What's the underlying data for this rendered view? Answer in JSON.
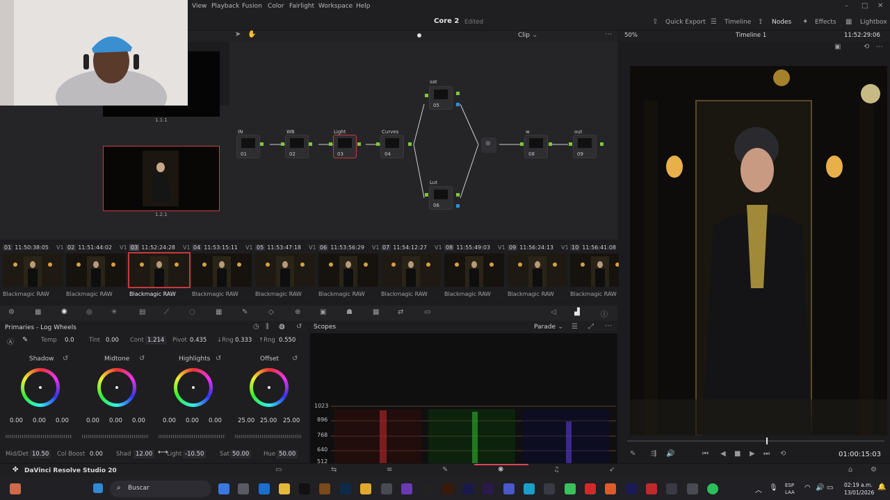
{
  "menu": {
    "items": [
      "View",
      "Playback",
      "Fusion",
      "Color",
      "Fairlight",
      "Workspace",
      "Help"
    ]
  },
  "header": {
    "project": "Core 2",
    "status": "Edited",
    "quick_export": "Quick Export",
    "timeline": "Timeline",
    "nodes": "Nodes",
    "effects": "Effects",
    "lightbox": "Lightbox"
  },
  "viewerbar": {
    "zoom": "50%",
    "timeline_name": "Timeline 1",
    "timecode": "11:52:29:06"
  },
  "nodebar": {
    "mode": "Clip"
  },
  "gallery": {
    "still1": "1.1.1",
    "still2": "1.2.1"
  },
  "nodes": [
    {
      "label": "IN",
      "num": "01"
    },
    {
      "label": "WB",
      "num": "02"
    },
    {
      "label": "Light",
      "num": "03"
    },
    {
      "label": "Curves",
      "num": "04"
    },
    {
      "label": "sat",
      "num": "05"
    },
    {
      "label": "Lut",
      "num": "06"
    },
    {
      "label": "w",
      "num": "08"
    },
    {
      "label": "out",
      "num": "09"
    }
  ],
  "clips": [
    {
      "num": "01",
      "tc": "11:50:38:05",
      "track": "V1",
      "codec": "Blackmagic RAW"
    },
    {
      "num": "02",
      "tc": "11:51:44:02",
      "track": "V1",
      "codec": "Blackmagic RAW"
    },
    {
      "num": "03",
      "tc": "11:52:24:28",
      "track": "V1",
      "codec": "Blackmagic RAW"
    },
    {
      "num": "04",
      "tc": "11:53:15:11",
      "track": "V1",
      "codec": "Blackmagic RAW"
    },
    {
      "num": "05",
      "tc": "11:53:47:18",
      "track": "V1",
      "codec": "Blackmagic RAW"
    },
    {
      "num": "06",
      "tc": "11:53:56:29",
      "track": "V1",
      "codec": "Blackmagic RAW"
    },
    {
      "num": "07",
      "tc": "11:54:12:27",
      "track": "V1",
      "codec": "Blackmagic RAW"
    },
    {
      "num": "08",
      "tc": "11:55:49:03",
      "track": "V1",
      "codec": "Blackmagic RAW"
    },
    {
      "num": "09",
      "tc": "11:56:24:13",
      "track": "V1",
      "codec": "Blackmagic RAW"
    },
    {
      "num": "10",
      "tc": "11:56:41:08",
      "track": "",
      "codec": "Blackmagic RAW"
    }
  ],
  "primaries": {
    "title": "Primaries - Log Wheels",
    "temp_label": "Temp",
    "temp": "0.0",
    "tint_label": "Tint",
    "tint": "0.00",
    "cont_label": "Cont",
    "cont": "1.214",
    "pivot_label": "Pivot",
    "pivot": "0.435",
    "lrng_label": "↓Rng",
    "lrng": "0.333",
    "hrng_label": "↑Rng",
    "hrng": "0.550",
    "wheels": [
      {
        "name": "Shadow",
        "v": [
          "0.00",
          "0.00",
          "0.00"
        ]
      },
      {
        "name": "Midtone",
        "v": [
          "0.00",
          "0.00",
          "0.00"
        ]
      },
      {
        "name": "Highlights",
        "v": [
          "0.00",
          "0.00",
          "0.00"
        ]
      },
      {
        "name": "Offset",
        "v": [
          "25.00",
          "25.00",
          "25.00"
        ]
      }
    ],
    "middet_label": "Mid/Det",
    "middet": "10.50",
    "colboost_label": "Col Boost",
    "colboost": "0.00",
    "shad_label": "Shad",
    "shad": "12.00",
    "light_label": "Light",
    "light": "-10.50",
    "sat_label": "Sat",
    "sat": "50.00",
    "hue_label": "Hue",
    "hue": "50.00"
  },
  "scopes": {
    "title": "Scopes",
    "mode": "Parade",
    "ticks": [
      "1023",
      "896",
      "768",
      "640",
      "512"
    ]
  },
  "transport": {
    "timecode": "01:00:15:03"
  },
  "app": {
    "name": "DaVinci Resolve Studio 20"
  },
  "taskbar": {
    "search": "Buscar",
    "lang1": "ESP",
    "lang2": "LAA",
    "time": "02:19 a.m.",
    "date": "13/01/2026"
  }
}
